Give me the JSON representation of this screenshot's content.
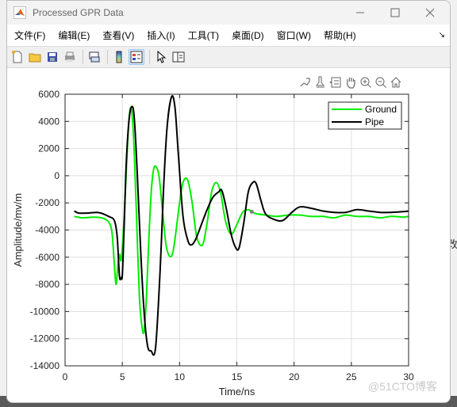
{
  "window": {
    "title": "Processed GPR Data",
    "controls": [
      "minimize",
      "maximize",
      "close"
    ]
  },
  "menubar": {
    "items": [
      "文件(F)",
      "编辑(E)",
      "查看(V)",
      "插入(I)",
      "工具(T)",
      "桌面(D)",
      "窗口(W)",
      "帮助(H)"
    ]
  },
  "toolbar": {
    "buttons": [
      "new-figure",
      "open-file",
      "save",
      "print",
      "link-plot",
      "colorbar",
      "legend",
      "pointer",
      "property-inspector"
    ]
  },
  "axes_toolbar": {
    "buttons": [
      "export",
      "brush",
      "data-tips",
      "pan",
      "zoom-in",
      "zoom-out",
      "restore-view"
    ]
  },
  "background_text": {
    "right_fragment": "改"
  },
  "watermark": "@51CTO博客",
  "chart_data": {
    "type": "line",
    "title": "",
    "xlabel": "Time/ns",
    "ylabel": "Amplitude/mv/m",
    "xlim": [
      0,
      30
    ],
    "ylim": [
      -14000,
      6000
    ],
    "xticks": [
      0,
      5,
      10,
      15,
      20,
      25,
      30
    ],
    "yticks": [
      6000,
      4000,
      2000,
      0,
      -2000,
      -4000,
      -6000,
      -8000,
      -10000,
      -12000,
      -14000
    ],
    "grid": true,
    "legend": {
      "position": "top-right",
      "entries": [
        "Ground",
        "Pipe"
      ]
    },
    "series": [
      {
        "name": "Ground",
        "color": "#00ee00",
        "x": [
          0.8,
          1.5,
          2.5,
          3.2,
          3.8,
          4.1,
          4.3,
          4.45,
          4.6,
          4.75,
          4.9,
          5.1,
          5.3,
          5.5,
          5.7,
          5.9,
          6.1,
          6.3,
          6.5,
          6.7,
          6.9,
          7.1,
          7.3,
          7.5,
          7.7,
          7.9,
          8.2,
          8.5,
          8.8,
          9.1,
          9.4,
          9.7,
          10.0,
          10.3,
          10.7,
          11.1,
          11.5,
          12.0,
          12.4,
          12.8,
          13.2,
          13.6,
          14.0,
          14.5,
          15.0,
          15.5,
          16.0,
          16.3,
          16.7,
          17.5,
          18.5,
          19.5,
          20.5,
          21.5,
          22.5,
          23.5,
          24.5,
          25.5,
          26.5,
          27.5,
          28.5,
          29.5,
          30.0
        ],
        "values": [
          -3000,
          -3100,
          -3050,
          -3100,
          -3400,
          -4200,
          -6500,
          -8000,
          -6700,
          -5800,
          -6200,
          -4000,
          -500,
          3000,
          5000,
          4000,
          500,
          -4500,
          -9000,
          -11000,
          -11500,
          -9000,
          -5000,
          -1500,
          300,
          700,
          0,
          -2500,
          -5000,
          -5900,
          -5700,
          -4000,
          -2000,
          -500,
          -300,
          -2000,
          -4500,
          -5100,
          -3500,
          -1200,
          -500,
          -1300,
          -3300,
          -4300,
          -3600,
          -2700,
          -2500,
          -2650,
          -2800,
          -2900,
          -3000,
          -2900,
          -2900,
          -3000,
          -3000,
          -3100,
          -2900,
          -3000,
          -3000,
          -3100,
          -3000,
          -3050,
          -3000
        ]
      },
      {
        "name": "Pipe",
        "color": "#000000",
        "x": [
          0.8,
          1.2,
          2.0,
          2.8,
          3.3,
          3.8,
          4.3,
          4.55,
          4.75,
          4.9,
          5.0,
          5.15,
          5.35,
          5.6,
          5.85,
          6.05,
          6.3,
          6.6,
          6.9,
          7.2,
          7.5,
          7.9,
          8.3,
          8.6,
          8.9,
          9.3,
          9.6,
          9.9,
          10.3,
          10.7,
          11.0,
          11.4,
          11.9,
          12.4,
          12.9,
          13.4,
          13.7,
          14.1,
          14.5,
          14.9,
          15.2,
          15.6,
          16.0,
          16.4,
          16.7,
          17.1,
          17.5,
          18.2,
          19.0,
          19.8,
          20.5,
          21.5,
          22.5,
          23.5,
          24.5,
          25.5,
          26.5,
          27.5,
          28.5,
          29.5,
          30.0
        ],
        "values": [
          -2600,
          -2750,
          -2750,
          -2700,
          -2800,
          -3000,
          -3300,
          -4500,
          -7400,
          -7500,
          -7300,
          -4000,
          1000,
          4200,
          5100,
          4200,
          300,
          -5500,
          -10000,
          -12500,
          -12900,
          -12700,
          -7000,
          -1000,
          3500,
          5800,
          5000,
          1500,
          -3000,
          -4700,
          -5100,
          -4700,
          -3600,
          -2500,
          -1600,
          -1200,
          -1100,
          -2500,
          -4300,
          -5300,
          -5300,
          -3500,
          -1200,
          -500,
          -600,
          -1800,
          -2800,
          -3200,
          -3300,
          -2700,
          -2300,
          -2400,
          -2600,
          -2700,
          -2700,
          -2500,
          -2600,
          -2700,
          -2700,
          -2650,
          -2600
        ]
      }
    ],
    "annotations": [
      {
        "type": "marker",
        "x": 16.3,
        "y": -2650,
        "color": "#808080"
      }
    ]
  }
}
